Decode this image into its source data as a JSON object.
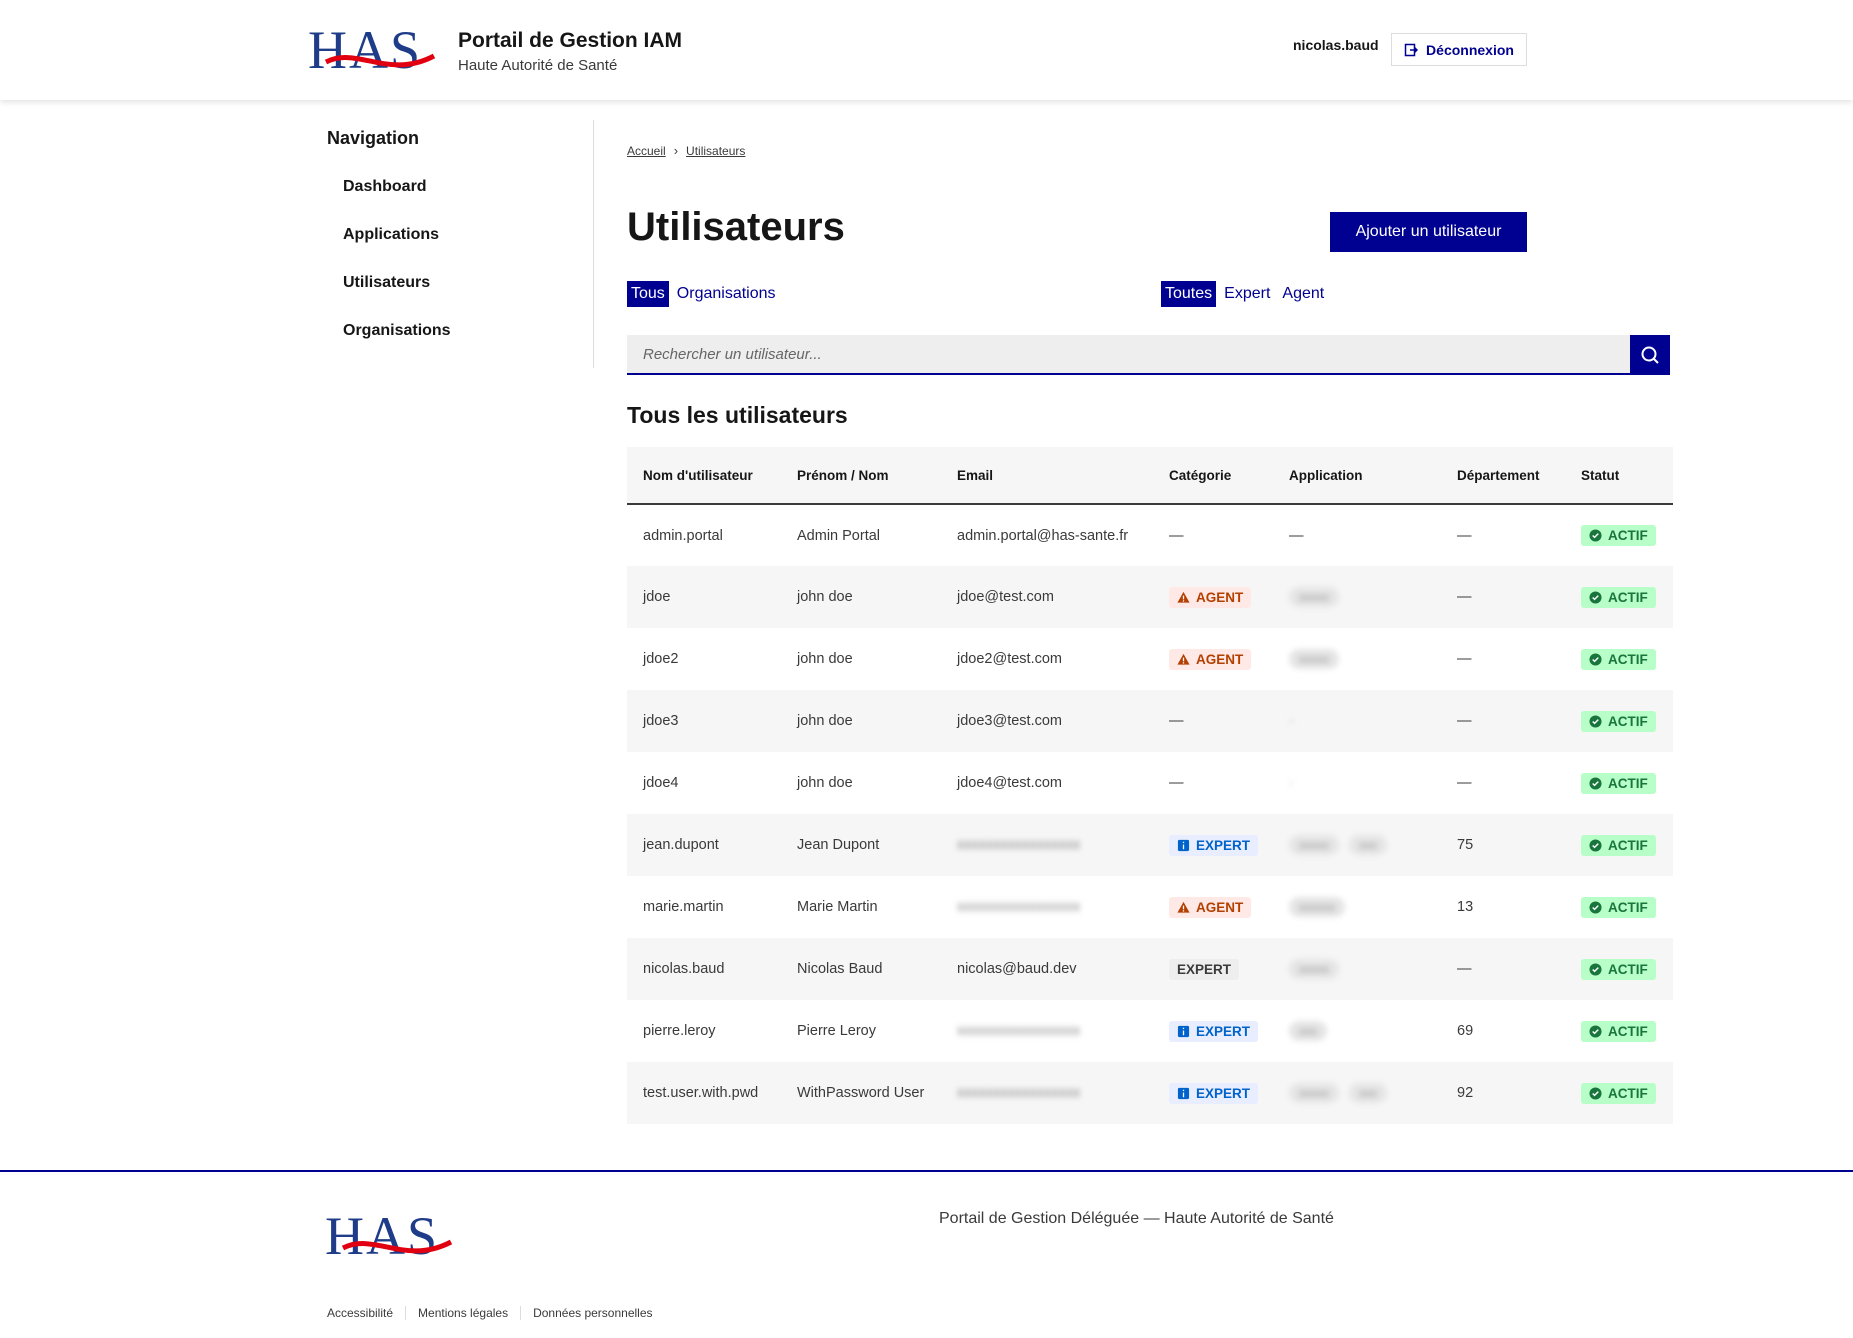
{
  "header": {
    "logo_text": "HAS",
    "title": "Portail de Gestion IAM",
    "subtitle": "Haute Autorité de Santé",
    "username": "nicolas.baud",
    "logout_label": "Déconnexion"
  },
  "sidebar": {
    "title": "Navigation",
    "items": [
      {
        "label": "Dashboard"
      },
      {
        "label": "Applications"
      },
      {
        "label": "Utilisateurs"
      },
      {
        "label": "Organisations"
      }
    ]
  },
  "breadcrumb": {
    "home": "Accueil",
    "current": "Utilisateurs"
  },
  "page": {
    "title": "Utilisateurs",
    "add_button": "Ajouter un utilisateur",
    "filters_left": [
      "Tous",
      "Organisations"
    ],
    "filters_right": [
      "Toutes",
      "Expert",
      "Agent"
    ],
    "search_placeholder": "Rechercher un utilisateur...",
    "section_title": "Tous les utilisateurs"
  },
  "table": {
    "headers": [
      "Nom d'utilisateur",
      "Prénom / Nom",
      "Email",
      "Catégorie",
      "Application",
      "Département",
      "Statut"
    ],
    "rows": [
      {
        "username": "admin.portal",
        "name": "Admin Portal",
        "email": "admin.portal@has-sante.fr",
        "category": "—",
        "application": "—",
        "department": "—",
        "status": "ACTIF"
      },
      {
        "username": "jdoe",
        "name": "john doe",
        "email": "jdoe@test.com",
        "category": "AGENT",
        "department": "—",
        "status": "ACTIF"
      },
      {
        "username": "jdoe2",
        "name": "john doe",
        "email": "jdoe2@test.com",
        "category": "AGENT",
        "department": "—",
        "status": "ACTIF"
      },
      {
        "username": "jdoe3",
        "name": "john doe",
        "email": "jdoe3@test.com",
        "category": "—",
        "department": "—",
        "status": "ACTIF"
      },
      {
        "username": "jdoe4",
        "name": "john doe",
        "email": "jdoe4@test.com",
        "category": "—",
        "department": "—",
        "status": "ACTIF"
      },
      {
        "username": "jean.dupont",
        "name": "Jean Dupont",
        "category": "EXPERT",
        "department": "75",
        "status": "ACTIF"
      },
      {
        "username": "marie.martin",
        "name": "Marie Martin",
        "category": "AGENT",
        "department": "13",
        "status": "ACTIF"
      },
      {
        "username": "nicolas.baud",
        "name": "Nicolas Baud",
        "email": "nicolas@baud.dev",
        "category": "EXPERT",
        "department": "—",
        "status": "ACTIF"
      },
      {
        "username": "pierre.leroy",
        "name": "Pierre Leroy",
        "category": "EXPERT",
        "department": "69",
        "status": "ACTIF"
      },
      {
        "username": "test.user.with.pwd",
        "name": "WithPassword User",
        "category": "EXPERT",
        "department": "92",
        "status": "ACTIF"
      }
    ]
  },
  "footer": {
    "logo_text": "HAS",
    "description": "Portail de Gestion Déléguée — Haute Autorité de Santé",
    "links": [
      "Accessibilité",
      "Mentions légales",
      "Données personnelles"
    ]
  },
  "colors": {
    "primary": "#000091",
    "agent": "#b34000",
    "expert": "#0063cb",
    "actif": "#18753c",
    "logo_red": "#e1000f",
    "logo_blue": "#1f3c88"
  }
}
